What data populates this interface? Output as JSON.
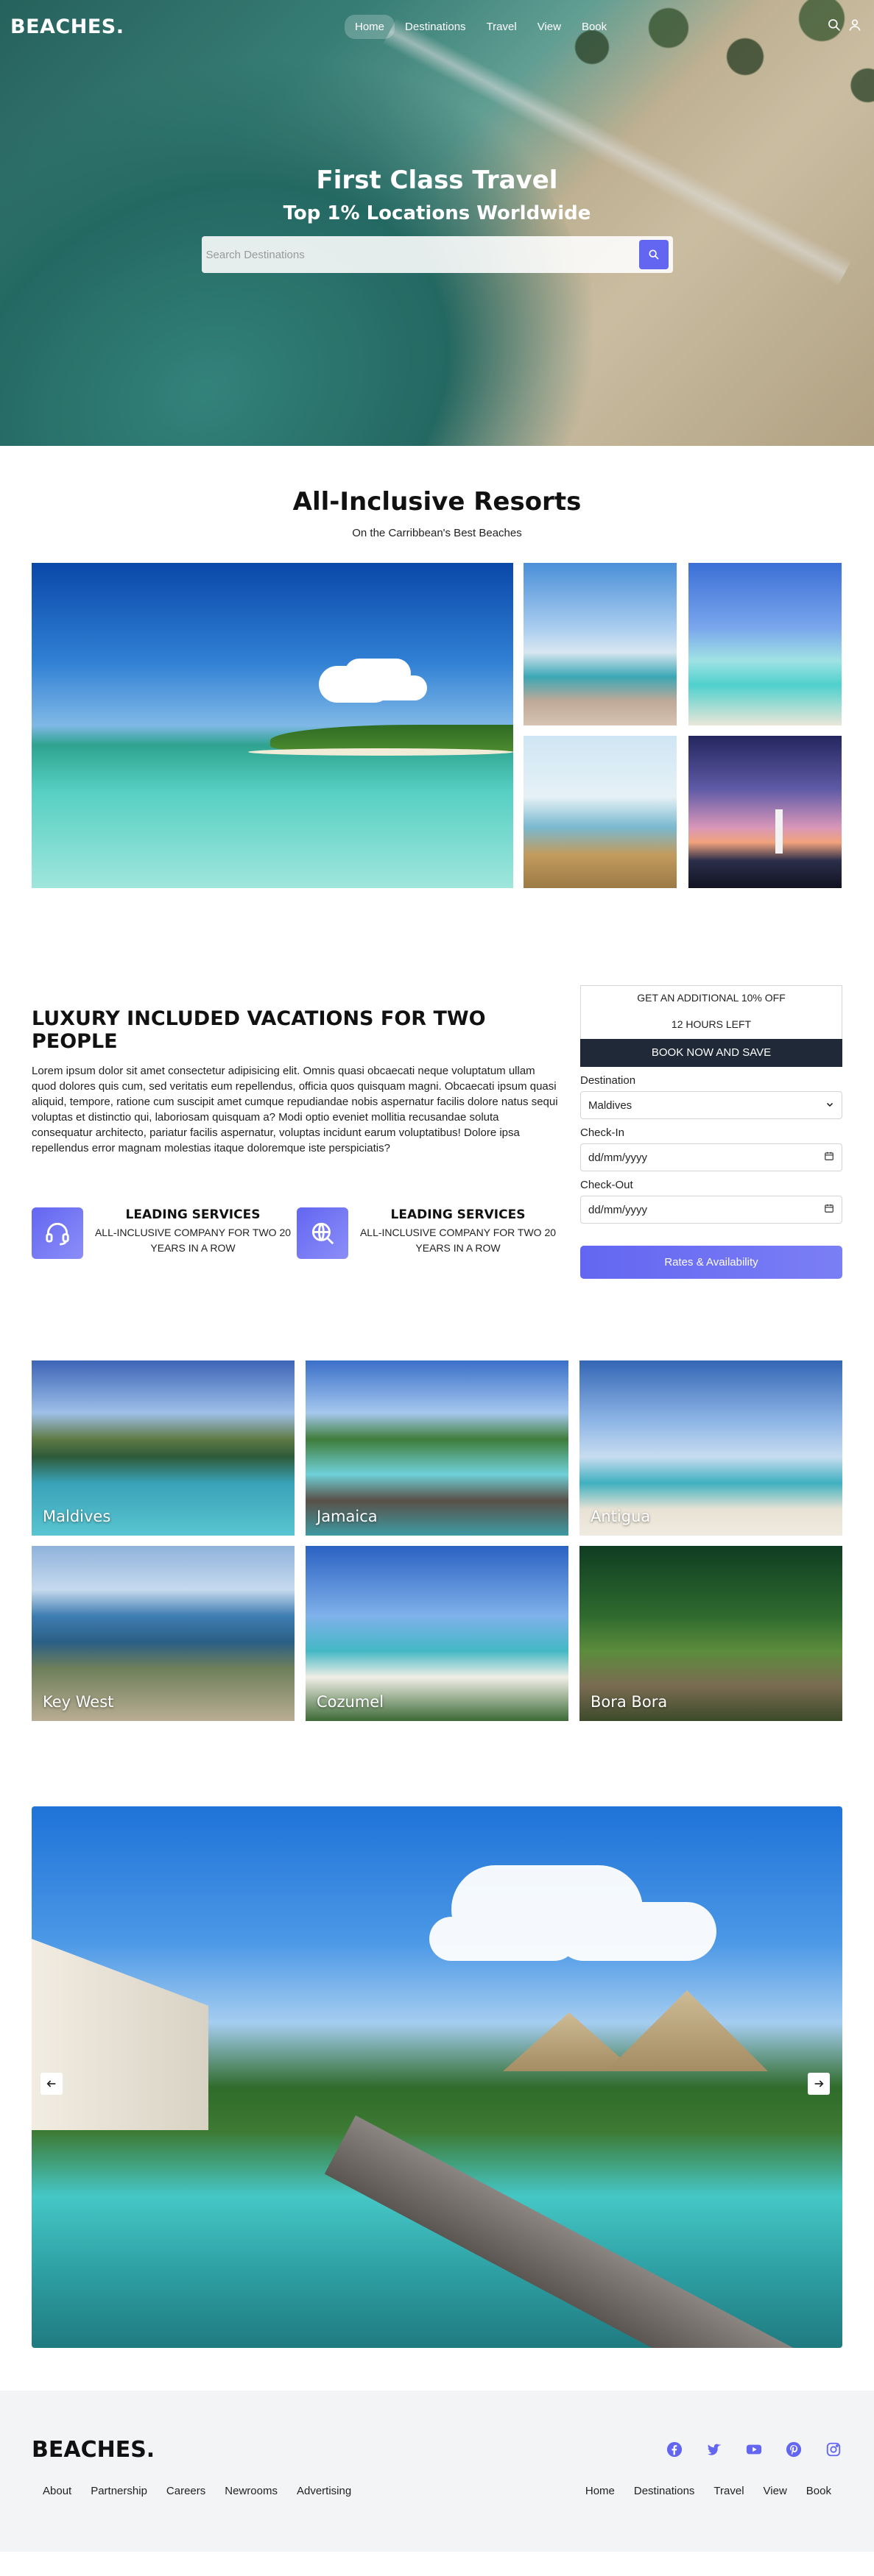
{
  "brand": {
    "logo": "BEACHES.",
    "accent": "#6366f1",
    "dark": "#1f2937"
  },
  "nav": {
    "links": [
      "Home",
      "Destinations",
      "Travel",
      "View",
      "Book"
    ],
    "active": "Home",
    "icons": [
      "search-icon",
      "user-icon"
    ]
  },
  "hero": {
    "title": "First Class Travel",
    "subtitle": "Top 1% Locations Worldwide",
    "search_placeholder": "Search Destinations"
  },
  "resorts": {
    "title": "All-Inclusive Resorts",
    "subtitle": "On the Carribbean's Best Beaches"
  },
  "luxury": {
    "title": "LUXURY INCLUDED VACATIONS FOR TWO PEOPLE",
    "text": "Lorem ipsum dolor sit amet consectetur adipisicing elit. Omnis quasi obcaecati neque voluptatum ullam quod dolores quis cum, sed veritatis eum repellendus, officia quos quisquam magni. Obcaecati ipsum quasi aliquid, tempore, ratione cum suscipit amet cumque repudiandae nobis aspernatur facilis dolore natus sequi voluptas et distinctio qui, laboriosam quisquam a? Modi optio eveniet mollitia recusandae soluta consequatur architecto, pariatur facilis aspernatur, voluptas incidunt earum voluptatibus! Dolore ipsa repellendus error magnam molestias itaque doloremque iste perspiciatis?",
    "services": [
      {
        "title": "LEADING SERVICES",
        "desc": "ALL-INCLUSIVE COMPANY FOR TWO 20 YEARS IN A ROW",
        "icon": "headset-icon"
      },
      {
        "title": "LEADING SERVICES",
        "desc": "ALL-INCLUSIVE COMPANY FOR TWO 20 YEARS IN A ROW",
        "icon": "globe-search-icon"
      }
    ]
  },
  "booking": {
    "offer": "GET AN ADDITIONAL 10% OFF",
    "countdown": "12 HOURS LEFT",
    "book_label": "BOOK NOW AND SAVE",
    "destination_label": "Destination",
    "destination_value": "Maldives",
    "checkin_label": "Check-In",
    "checkin_placeholder": "dd/mm/yyyy",
    "checkout_label": "Check-Out",
    "checkout_placeholder": "dd/mm/yyyy",
    "rates_label": "Rates & Availability"
  },
  "destinations": [
    "Maldives",
    "Jamaica",
    "Antigua",
    "Key West",
    "Cozumel",
    "Bora Bora"
  ],
  "carousel": {
    "prev_icon": "arrow-left-icon",
    "next_icon": "arrow-right-icon"
  },
  "footer": {
    "logo": "BEACHES.",
    "social": [
      "facebook-icon",
      "twitter-icon",
      "youtube-icon",
      "pinterest-icon",
      "instagram-icon"
    ],
    "left_links": [
      "About",
      "Partnership",
      "Careers",
      "Newrooms",
      "Advertising"
    ],
    "right_links": [
      "Home",
      "Destinations",
      "Travel",
      "View",
      "Book"
    ]
  }
}
